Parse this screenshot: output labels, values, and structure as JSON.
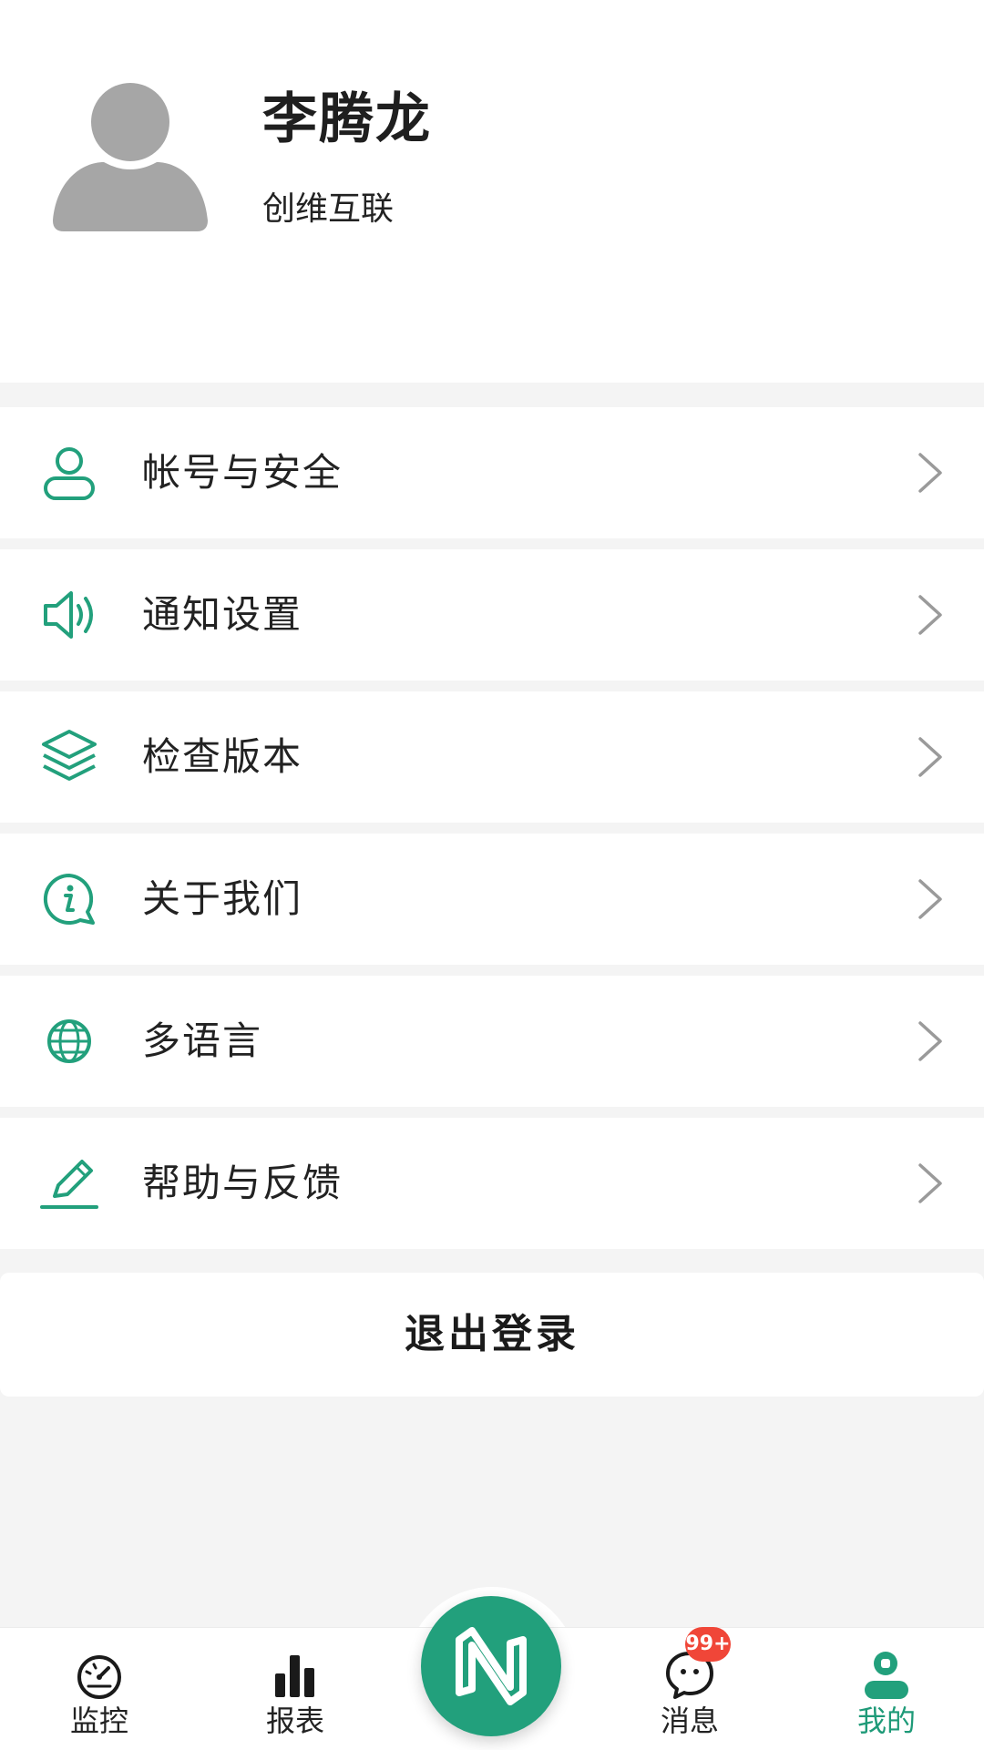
{
  "profile": {
    "name": "李腾龙",
    "company": "创维互联"
  },
  "menu": {
    "items": [
      {
        "label": "帐号与安全",
        "icon": "user-icon"
      },
      {
        "label": "通知设置",
        "icon": "speaker-icon"
      },
      {
        "label": "检查版本",
        "icon": "layers-icon"
      },
      {
        "label": "关于我们",
        "icon": "info-icon"
      },
      {
        "label": "多语言",
        "icon": "globe-icon"
      },
      {
        "label": "帮助与反馈",
        "icon": "pencil-icon"
      }
    ]
  },
  "logout_label": "退出登录",
  "tabbar": {
    "tabs": [
      {
        "label": "监控",
        "icon": "gauge-icon"
      },
      {
        "label": "报表",
        "icon": "bar-chart-icon"
      },
      {
        "label": "消息",
        "icon": "chat-icon"
      },
      {
        "label": "我的",
        "icon": "person-icon"
      }
    ],
    "center_icon": "app-logo-icon",
    "badge": "99+",
    "active_tab": "我的"
  },
  "colors": {
    "accent": "#22a07c",
    "badge": "#f04638",
    "background": "#f4f4f4"
  }
}
